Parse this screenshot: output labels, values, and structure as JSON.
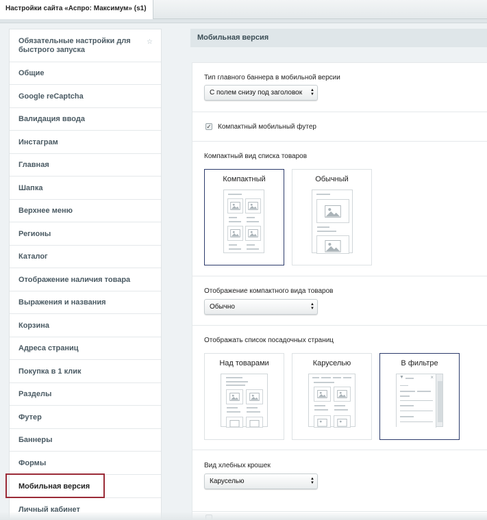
{
  "tab": {
    "title": "Настройки сайта «Аспро: Максимум» (s1)"
  },
  "sidebar": {
    "items": [
      {
        "label": "Обязательные настройки для быстрого запуска"
      },
      {
        "label": "Общие"
      },
      {
        "label": "Google reCaptcha"
      },
      {
        "label": "Валидация ввода"
      },
      {
        "label": "Инстаграм"
      },
      {
        "label": "Главная"
      },
      {
        "label": "Шапка"
      },
      {
        "label": "Верхнее меню"
      },
      {
        "label": "Регионы"
      },
      {
        "label": "Каталог"
      },
      {
        "label": "Отображение наличия товара"
      },
      {
        "label": "Выражения и названия"
      },
      {
        "label": "Корзина"
      },
      {
        "label": "Адреса страниц"
      },
      {
        "label": "Покупка в 1 клик"
      },
      {
        "label": "Разделы"
      },
      {
        "label": "Футер"
      },
      {
        "label": "Баннеры"
      },
      {
        "label": "Формы"
      },
      {
        "label": "Мобильная версия"
      },
      {
        "label": "Личный кабинет"
      }
    ],
    "active": "Мобильная версия"
  },
  "content": {
    "header": "Мобильная версия",
    "banner_type": {
      "label": "Тип главного баннера в мобильной версии",
      "value": "С полем снизу под заголовок"
    },
    "compact_footer": {
      "label": "Компактный мобильный футер",
      "checked": true
    },
    "product_list_view": {
      "label": "Компактный вид списка товаров",
      "options": [
        {
          "title": "Компактный",
          "selected": true
        },
        {
          "title": "Обычный",
          "selected": false
        }
      ]
    },
    "compact_display": {
      "label": "Отображение компактного вида товаров",
      "value": "Обычно"
    },
    "landing_pages": {
      "label": "Отображать список посадочных страниц",
      "options": [
        {
          "title": "Над товарами",
          "selected": false
        },
        {
          "title": "Каруселью",
          "selected": false
        },
        {
          "title": "В фильтре",
          "selected": true
        }
      ]
    },
    "breadcrumbs": {
      "label": "Вид хлебных крошек",
      "value": "Каруселью"
    }
  },
  "colors": {
    "accent_border": "#2b3a6b",
    "active_frame": "#9a2a36"
  }
}
